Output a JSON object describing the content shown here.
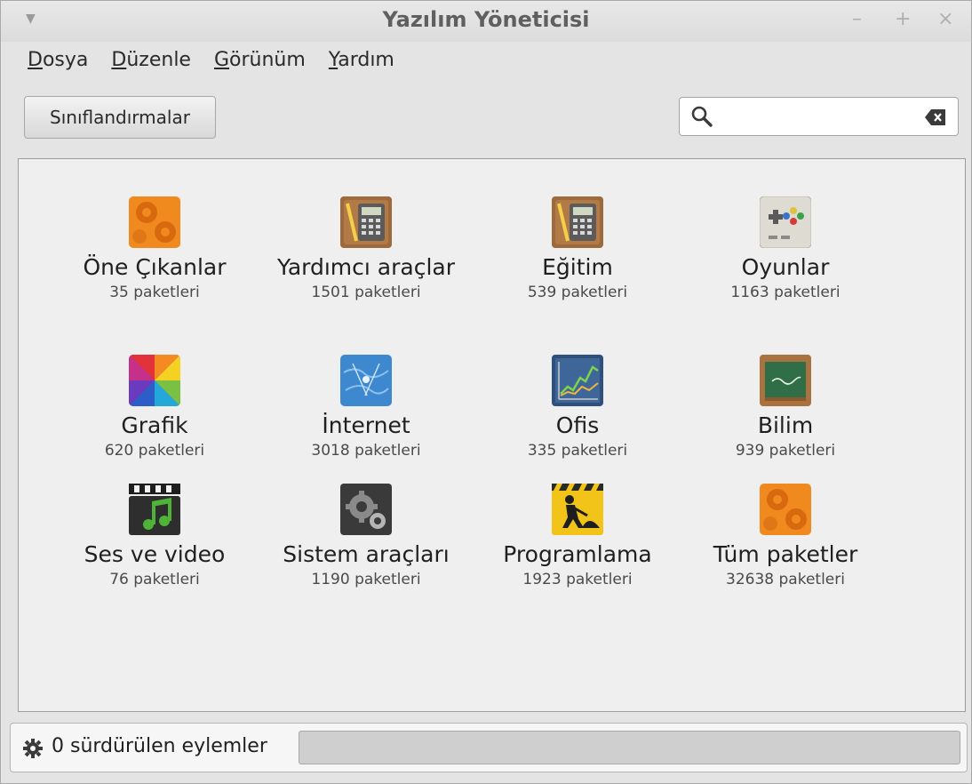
{
  "window": {
    "title": "Yazılım Yöneticisi"
  },
  "menubar": {
    "items": [
      {
        "mnemonic": "D",
        "rest": "osya"
      },
      {
        "mnemonic": "D",
        "rest": "üzenle"
      },
      {
        "mnemonic": "G",
        "rest": "örünüm"
      },
      {
        "mnemonic": "Y",
        "rest": "ardım"
      }
    ]
  },
  "toolbar": {
    "categories_button": "Sınıflandırmalar"
  },
  "search": {
    "value": "",
    "placeholder": ""
  },
  "categories": [
    {
      "name": "Öne Çıkanlar",
      "count": "35 paketleri",
      "icon": "featured-gears-icon"
    },
    {
      "name": "Yardımcı araçlar",
      "count": "1501 paketleri",
      "icon": "calculator-icon"
    },
    {
      "name": "Eğitim",
      "count": "539 paketleri",
      "icon": "calculator-icon"
    },
    {
      "name": "Oyunlar",
      "count": "1163 paketleri",
      "icon": "gamepad-icon"
    },
    {
      "name": "Grafik",
      "count": "620 paketleri",
      "icon": "color-wheel-icon"
    },
    {
      "name": "İnternet",
      "count": "3018 paketleri",
      "icon": "globe-icon"
    },
    {
      "name": "Ofis",
      "count": "335 paketleri",
      "icon": "chart-icon"
    },
    {
      "name": "Bilim",
      "count": "939 paketleri",
      "icon": "chalkboard-icon"
    },
    {
      "name": "Ses ve video",
      "count": "76 paketleri",
      "icon": "clapperboard-music-icon"
    },
    {
      "name": "Sistem araçları",
      "count": "1190 paketleri",
      "icon": "system-gear-icon"
    },
    {
      "name": "Programlama",
      "count": "1923 paketleri",
      "icon": "construction-worker-icon"
    },
    {
      "name": "Tüm paketler",
      "count": "32638 paketleri",
      "icon": "all-packages-gears-icon"
    }
  ],
  "status": {
    "text": "0 sürdürülen eylemler",
    "progress": 0
  }
}
